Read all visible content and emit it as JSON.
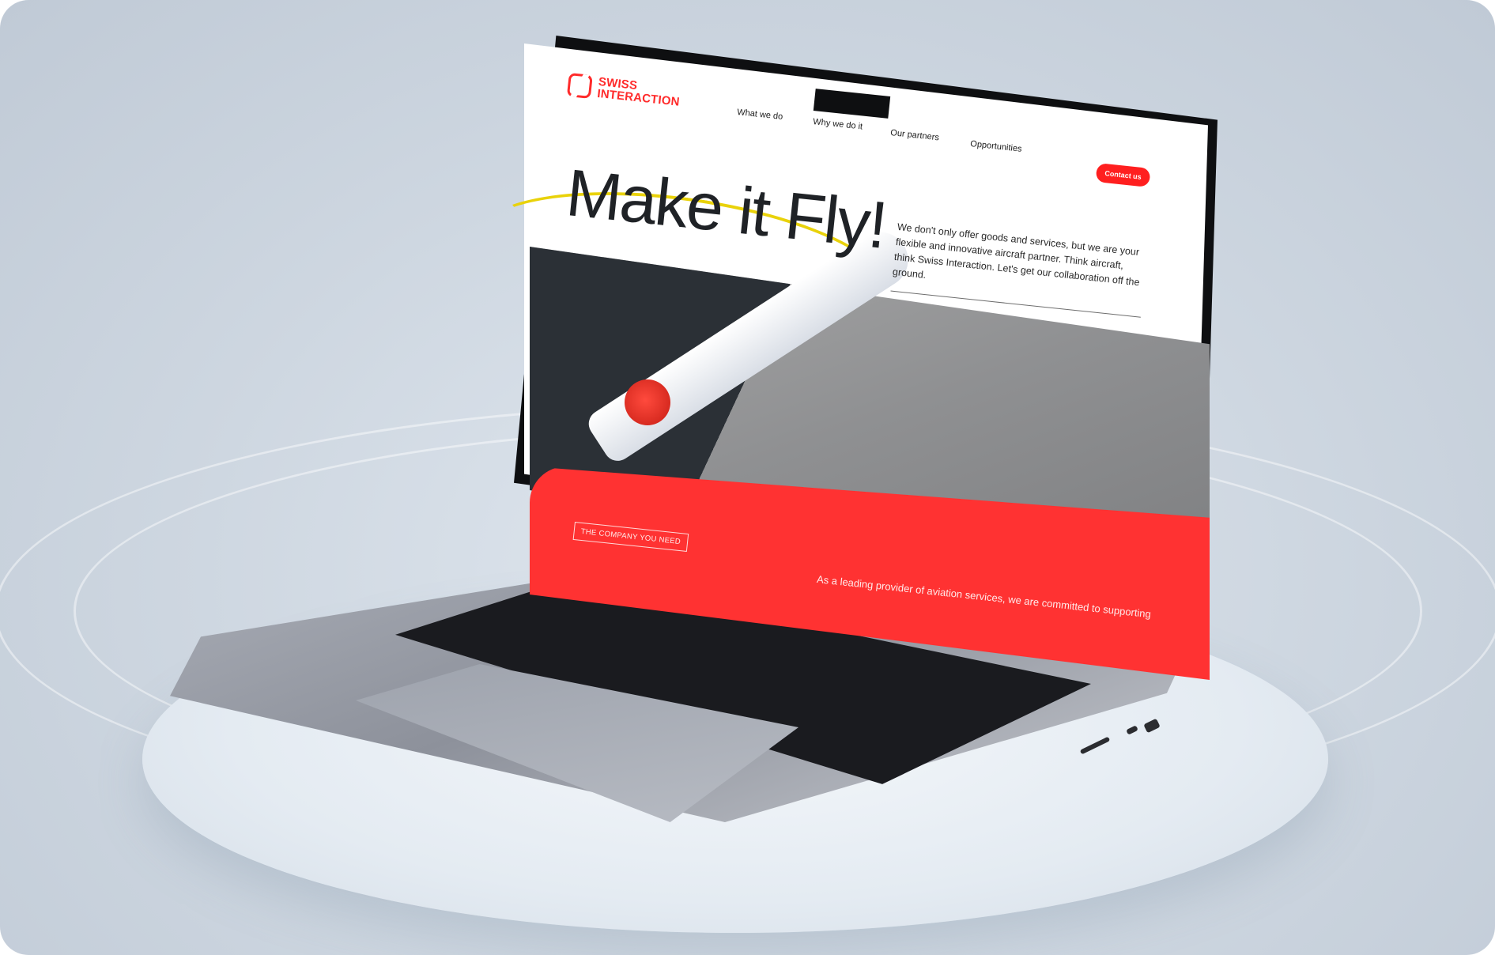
{
  "site": {
    "logo_line1": "SWISS",
    "logo_line2": "INTERACTION",
    "nav": [
      "What we do",
      "Why we do it",
      "Our partners",
      "Opportunities"
    ],
    "contact_button": "Contact us"
  },
  "hero": {
    "title": "Make it Fly!",
    "description": "We don't only offer goods and services, but we are your flexible and innovative aircraft partner. Think aircraft, think Swiss Interaction. Let's get our collaboration off the ground."
  },
  "company_section": {
    "badge": "THE COMPANY YOU NEED",
    "tagline": "As a leading provider of aviation services, we are committed to supporting"
  },
  "colors": {
    "brand_red": "#ff2b2b",
    "text_dark": "#1f2226",
    "background": "#cdd6e0"
  }
}
